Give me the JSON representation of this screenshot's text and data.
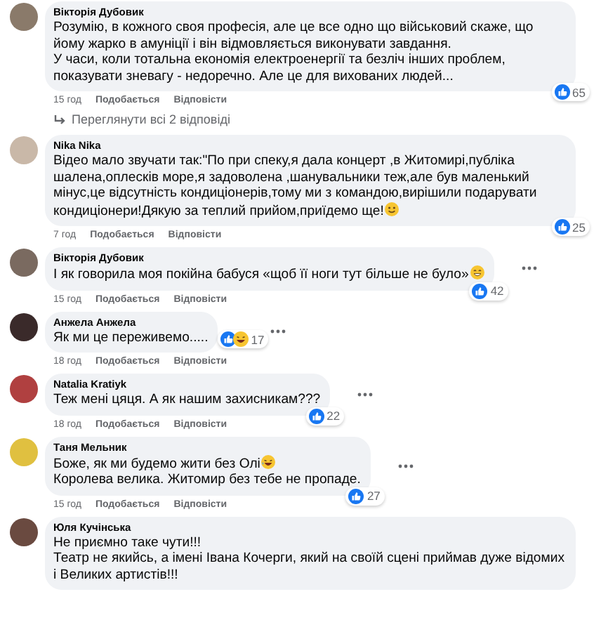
{
  "comments": [
    {
      "author": "Вікторія Дубовик",
      "paragraphs": [
        {
          "kind": "plain",
          "text": "Розумію, в кожного своя професія, але це все одно що військовий скаже, що йому жарко в амуніції і він відмовляється виконувати завдання."
        },
        {
          "kind": "plain",
          "text": "У часи, коли тотальна економія електроенергії та безліч інших проблем, показувати зневагу - недоречно. Але це для вихованих людей..."
        }
      ],
      "time": "15 год",
      "like_label": "Подобається",
      "reply_label": "Відповісти",
      "reactions": {
        "kind": "like",
        "count": "65"
      },
      "menu": false,
      "replies_link": "Переглянути всі 2 відповіді"
    },
    {
      "author": "Nika Nika",
      "paragraphs": [
        {
          "kind": "smile",
          "text": "Відео мало звучати так:\"По при спеку,я дала концерт ,в Житомирі,публіка шалена,оплесків море,я задоволена ,шанувальники теж,але був маленький мінус,це відсутність кондиціонерів,тому ми з командою,вирішили подарувати кондиціонери!Дякую за теплий прийом,приїдемо ще!"
        }
      ],
      "time": "7 год",
      "like_label": "Подобається",
      "reply_label": "Відповісти",
      "reactions": {
        "kind": "like",
        "count": "25"
      },
      "menu": false
    },
    {
      "author": "Вікторія Дубовик",
      "paragraphs": [
        {
          "kind": "grin",
          "text": "І як говорила моя покійна бабуся «щоб її ноги тут більше не було»"
        }
      ],
      "time": "15 год",
      "like_label": "Подобається",
      "reply_label": "Відповісти",
      "reactions": {
        "kind": "like",
        "count": "42"
      },
      "menu": true
    },
    {
      "author": "Анжела Анжела",
      "paragraphs": [
        {
          "kind": "plain",
          "text": "Як ми це переживемо....."
        }
      ],
      "time": "18 год",
      "like_label": "Подобається",
      "reply_label": "Відповісти",
      "reactions": {
        "kind": "like-haha",
        "count": "17"
      },
      "menu": true
    },
    {
      "author": "Natalia Kratiyk",
      "paragraphs": [
        {
          "kind": "plain",
          "text": "Теж мені цяця. А як нашим захисникам???"
        }
      ],
      "time": "18 год",
      "like_label": "Подобається",
      "reply_label": "Відповісти",
      "reactions": {
        "kind": "like",
        "count": "22"
      },
      "menu": true
    },
    {
      "author": "Таня Мельник",
      "paragraphs": [
        {
          "kind": "laugh",
          "text": "Боже, як ми будемо жити без Олі"
        },
        {
          "kind": "plain",
          "text": "Королева велика. Житомир без тебе не пропаде."
        }
      ],
      "time": "15 год",
      "like_label": "Подобається",
      "reply_label": "Відповісти",
      "reactions": {
        "kind": "like",
        "count": "27"
      },
      "menu": true
    },
    {
      "author": "Юля Кучінська",
      "paragraphs": [
        {
          "kind": "plain",
          "text": "Не приємно таке чути!!!"
        },
        {
          "kind": "plain",
          "text": "Театр не якийсь, а імені Івана Кочерги, який на своїй сцені приймав дуже відомих і Великих артистів!!!"
        }
      ],
      "menu": false
    }
  ]
}
